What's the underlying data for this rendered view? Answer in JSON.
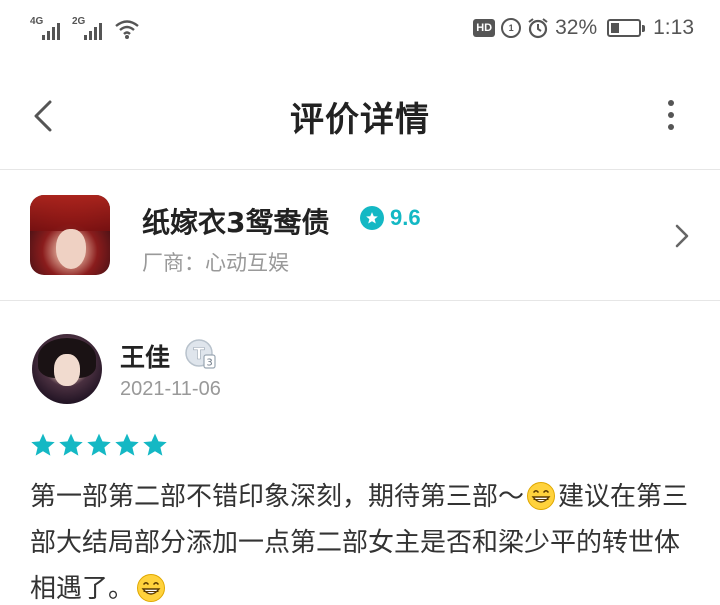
{
  "status_bar": {
    "signal_1_label": "4G",
    "signal_2_label": "2G",
    "hd_label": "HD",
    "data_saver_label": "1",
    "battery_percent": "32%",
    "battery_level": 0.32,
    "time": "1:13",
    "icons": [
      "signal-icon",
      "signal-icon",
      "wifi-icon",
      "hd-icon",
      "data-saver-icon",
      "alarm-icon",
      "battery-icon"
    ]
  },
  "header": {
    "title": "评价详情",
    "back_icon": "back-arrow-icon",
    "more_icon": "more-vertical-icon"
  },
  "app_card": {
    "name": "纸嫁衣3鸳鸯债",
    "rating": "9.6",
    "developer_label": "厂商：",
    "developer": "心动互娱",
    "rating_color": "#14b8c4"
  },
  "review": {
    "user_name": "王佳",
    "level_badge": "T3",
    "date": "2021-11-06",
    "stars": 5,
    "star_color": "#14b8c4",
    "text_part1": "第一部第二部不错印象深刻，期待第三部～",
    "text_part2": "建议在第三部大结局部分添加一点第二部女主是否和梁少平的转世体相遇了。",
    "emoji_icon": "grinning-emoji-icon"
  }
}
